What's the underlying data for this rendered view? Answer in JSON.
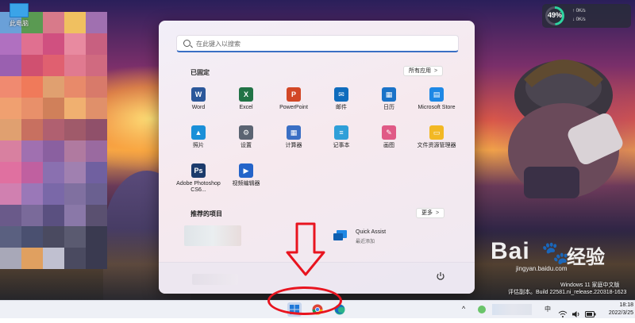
{
  "desktop": {
    "icon_label": "此电脑"
  },
  "perf_widget": {
    "percent": "49%",
    "percent_value": 0.49,
    "up": "0K/s",
    "down": "0K/s"
  },
  "start_menu": {
    "search_placeholder": "在此键入以搜索",
    "pinned_title": "已固定",
    "all_apps_label": "所有应用",
    "all_apps_chevron": ">",
    "pinned_apps": [
      {
        "label": "Word",
        "icon": "word-icon",
        "color": "#2b579a"
      },
      {
        "label": "Excel",
        "icon": "excel-icon",
        "color": "#217346"
      },
      {
        "label": "PowerPoint",
        "icon": "powerpoint-icon",
        "color": "#d24726"
      },
      {
        "label": "邮件",
        "icon": "mail-icon",
        "color": "#0f6cbd"
      },
      {
        "label": "日历",
        "icon": "calendar-icon",
        "color": "#1a73c8"
      },
      {
        "label": "Microsoft Store",
        "icon": "store-icon",
        "color": "#1e88e5"
      },
      {
        "label": "照片",
        "icon": "photos-icon",
        "color": "#1a8fd8"
      },
      {
        "label": "设置",
        "icon": "settings-icon",
        "color": "#5b6472"
      },
      {
        "label": "计算器",
        "icon": "calculator-icon",
        "color": "#3a6fc4"
      },
      {
        "label": "记事本",
        "icon": "notepad-icon",
        "color": "#2f9fd8"
      },
      {
        "label": "画图",
        "icon": "paint-icon",
        "color": "#e05a86"
      },
      {
        "label": "文件资源管理器",
        "icon": "file-explorer-icon",
        "color": "#f2b824"
      },
      {
        "label": "Adobe Photoshop CS6...",
        "icon": "photoshop-icon",
        "color": "#1b3a6b"
      },
      {
        "label": "视频编辑器",
        "icon": "video-editor-icon",
        "color": "#2464c9"
      }
    ],
    "recommended_title": "推荐的项目",
    "more_label": "更多",
    "more_chevron": ">",
    "recommended": [
      {
        "title": "Quick Assist",
        "subtitle": "最近添加",
        "icon": "quick-assist-icon"
      }
    ]
  },
  "watermark": {
    "logo_text": "Bai",
    "logo_suffix": "经验",
    "url": "jingyan.baidu.com",
    "version_line1": "Windows 11 家庭中文版",
    "version_line2": "评估副本。Build 22581.ni_release.220318-1623"
  },
  "taskbar": {
    "time": "18:18",
    "date": "2022/3/25",
    "ime": "中",
    "tray_chevron": "^"
  },
  "annotation": {
    "arrow_color": "#e8141f"
  }
}
